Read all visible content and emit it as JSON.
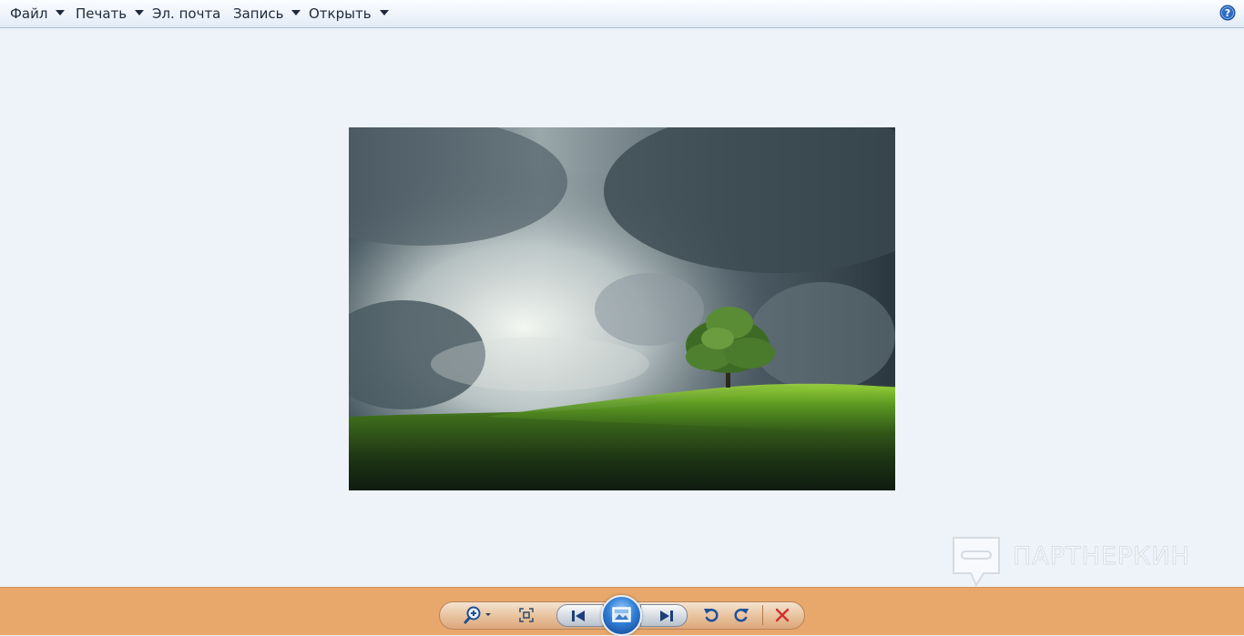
{
  "menu": {
    "file": "Файл",
    "print": "Печать",
    "email": "Эл. почта",
    "burn": "Запись",
    "open": "Открыть"
  },
  "icons": {
    "help": "help-icon",
    "zoom": "zoom-icon",
    "actual_size": "actual-size-icon",
    "previous": "previous-icon",
    "slideshow": "slideshow-icon",
    "next": "next-icon",
    "rotate_ccw": "rotate-counterclockwise-icon",
    "rotate_cw": "rotate-clockwise-icon",
    "delete": "delete-icon"
  },
  "watermark": {
    "text": "ПАРТНЕРКИН"
  },
  "colors": {
    "background": "#eef3f9",
    "toolbar": "#e8a76b",
    "delete": "#d0312d",
    "accent": "#2f7fd6"
  }
}
